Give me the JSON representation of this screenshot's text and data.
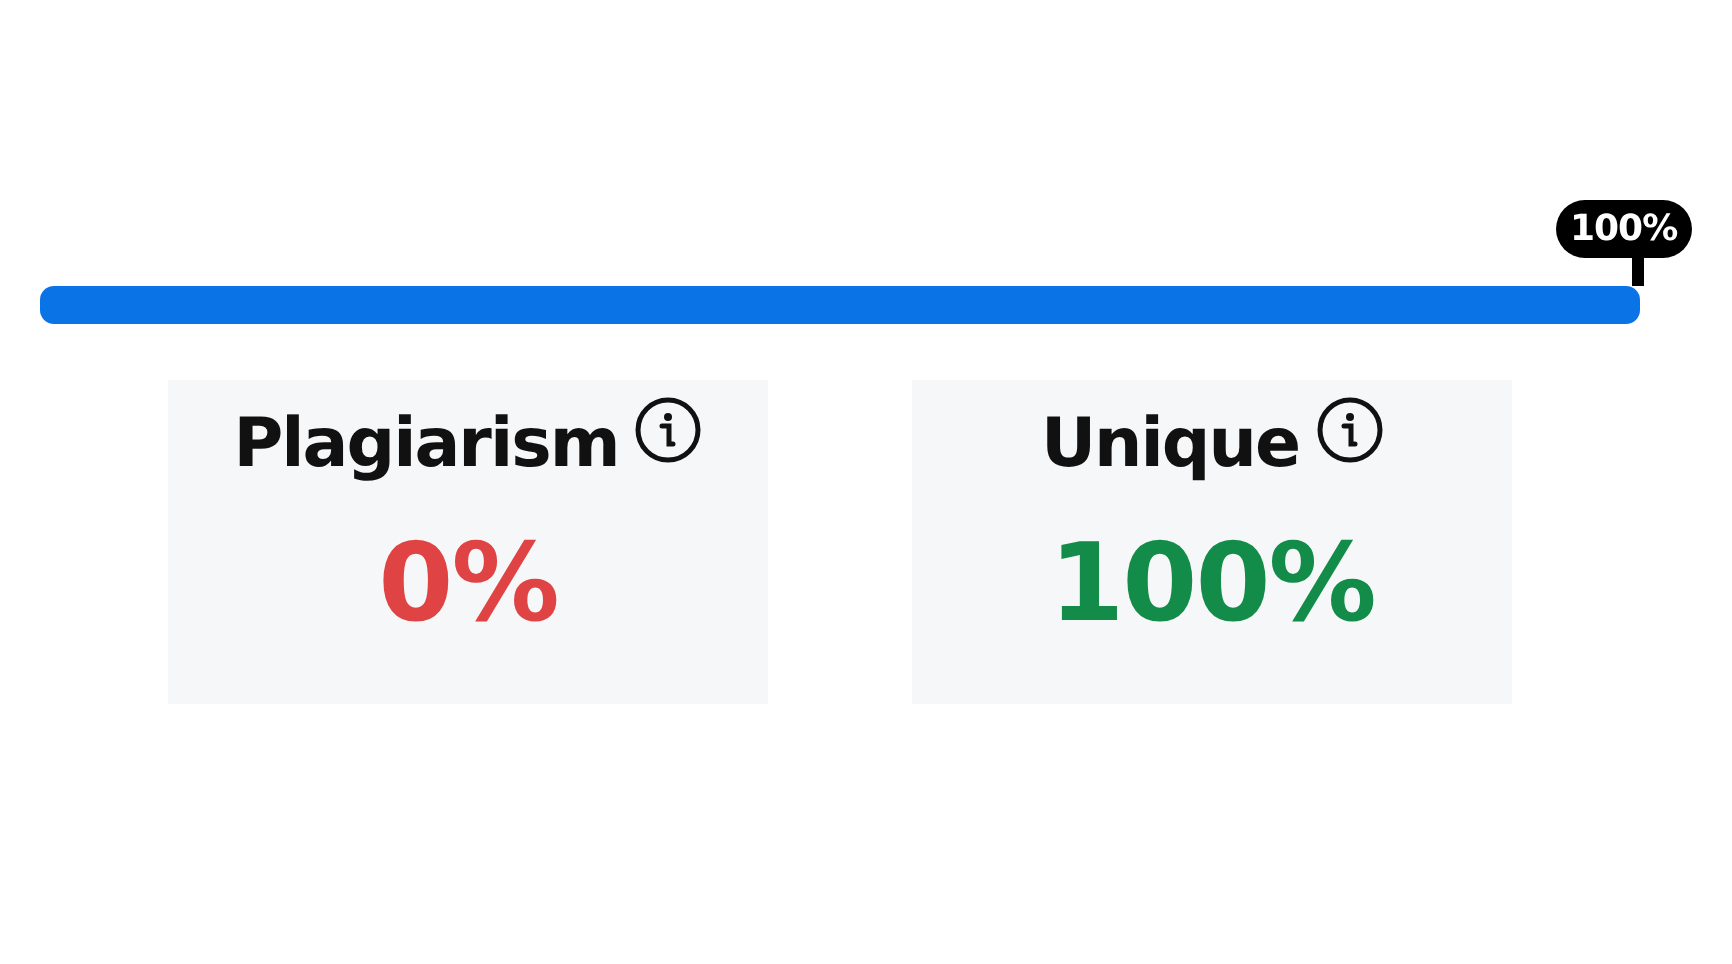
{
  "progress": {
    "label": "100%"
  },
  "metrics": [
    {
      "title": "Plagiarism",
      "value": "0%",
      "color": "#e04343"
    },
    {
      "title": "Unique",
      "value": "100%",
      "color": "#128c48"
    }
  ]
}
